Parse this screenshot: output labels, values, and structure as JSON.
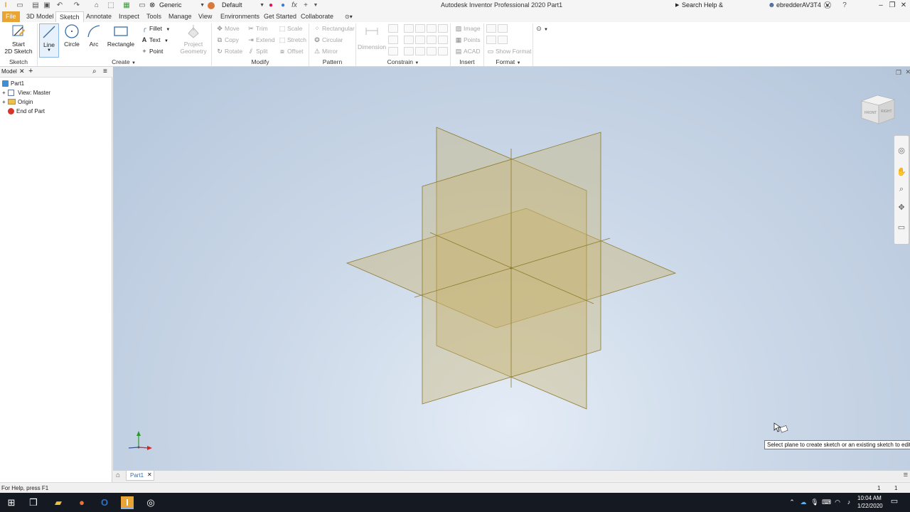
{
  "titlebar": {
    "app_title": "Autodesk Inventor Professional 2020   Part1",
    "material": "Generic",
    "appearance": "Default",
    "search_placeholder": "Search Help & Commands...",
    "user": "ebredderAV3T4"
  },
  "tabs": [
    "File",
    "3D Model",
    "Sketch",
    "Annotate",
    "Inspect",
    "Tools",
    "Manage",
    "View",
    "Environments",
    "Get Started",
    "Collaborate"
  ],
  "active_tab": "Sketch",
  "ribbon": {
    "start_sketch": "Start\n2D Sketch",
    "start_sketch_l1": "Start",
    "start_sketch_l2": "2D Sketch",
    "line": "Line",
    "circle": "Circle",
    "arc": "Arc",
    "rectangle": "Rectangle",
    "fillet": "Fillet",
    "text": "Text",
    "point": "Point",
    "project_geometry_l1": "Project",
    "project_geometry_l2": "Geometry",
    "move": "Move",
    "copy": "Copy",
    "rotate": "Rotate",
    "trim": "Trim",
    "extend": "Extend",
    "split": "Split",
    "scale": "Scale",
    "stretch": "Stretch",
    "offset": "Offset",
    "rectangular": "Rectangular",
    "circular": "Circular",
    "mirror": "Mirror",
    "dimension": "Dimension",
    "image": "Image",
    "points": "Points",
    "acad": "ACAD",
    "show_format": "Show Format",
    "panels": {
      "sketch": "Sketch",
      "create": "Create",
      "modify": "Modify",
      "pattern": "Pattern",
      "constrain": "Constrain",
      "insert": "Insert",
      "format": "Format"
    }
  },
  "browser": {
    "tab": "Model",
    "items": [
      "Part1",
      "View: Master",
      "Origin",
      "End of Part"
    ]
  },
  "viewcube": {
    "front": "FRONT",
    "right": "RIGHT"
  },
  "tooltip": "Select plane to create sketch or an existing sketch to edit",
  "doc_tab": "Part1",
  "status": {
    "help": "For Help, press F1",
    "count1": "1",
    "count2": "1"
  },
  "taskbar": {
    "time": "10:04 AM",
    "date": "1/22/2020"
  },
  "colors": {
    "accent": "#e8a535",
    "plane_fill": "#c9b36f",
    "plane_edge": "#8c7a2c"
  }
}
